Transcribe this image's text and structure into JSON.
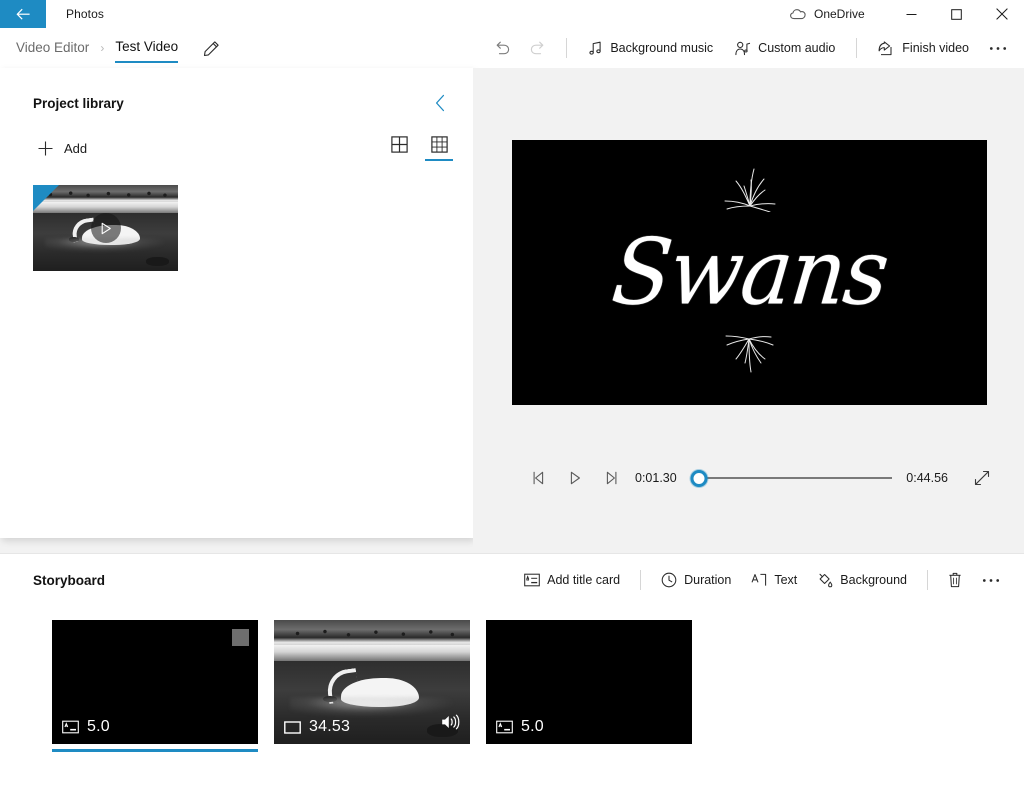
{
  "titlebar": {
    "back_icon": "back-arrow-icon",
    "app_name": "Photos",
    "onedrive_label": "OneDrive",
    "onedrive_icon": "cloud-icon",
    "minimize_icon": "minimize-icon",
    "maximize_icon": "maximize-icon",
    "close_icon": "close-icon"
  },
  "commandbar": {
    "breadcrumb": {
      "parent": "Video Editor",
      "separator": "›",
      "current": "Test Video"
    },
    "rename_icon": "pencil-icon",
    "undo_label": "Undo",
    "undo_icon": "undo-icon",
    "redo_label": "Redo",
    "redo_icon": "redo-icon",
    "background_music_label": "Background music",
    "background_music_icon": "music-note-icon",
    "custom_audio_label": "Custom audio",
    "custom_audio_icon": "person-audio-icon",
    "finish_video_label": "Finish video",
    "finish_video_icon": "share-export-icon",
    "more_label": "See more",
    "more_icon": "ellipsis-icon"
  },
  "library": {
    "title": "Project library",
    "collapse_icon": "chevron-left-icon",
    "add_label": "Add",
    "add_icon": "plus-icon",
    "view_large_icon": "grid-large-icon",
    "view_small_icon": "grid-small-icon",
    "active_view": "small",
    "items": [
      {
        "name": "swan-video-thumbnail",
        "selected": true,
        "play_icon": "play-icon"
      }
    ]
  },
  "preview": {
    "title_card_text": "Swans",
    "ornament_icon": "sparkle-icon",
    "controls": {
      "prev_frame_icon": "previous-frame-icon",
      "play_icon": "play-icon",
      "next_frame_icon": "next-frame-icon",
      "current_time": "0:01.30",
      "total_time": "0:44.56",
      "progress_percent": 4,
      "fullscreen_icon": "expand-icon"
    }
  },
  "storyboard": {
    "title": "Storyboard",
    "add_title_card_label": "Add title card",
    "add_title_card_icon": "title-card-icon",
    "duration_label": "Duration",
    "duration_icon": "clock-icon",
    "text_label": "Text",
    "text_icon": "text-icon",
    "background_label": "Background",
    "background_icon": "paint-bucket-icon",
    "delete_label": "Delete",
    "delete_icon": "trash-icon",
    "more_label": "See more",
    "more_icon": "ellipsis-icon",
    "clips": [
      {
        "kind": "title-card",
        "duration": "5.0",
        "type_icon": "title-card-icon",
        "selected": true,
        "checked": true,
        "has_audio": false
      },
      {
        "kind": "video",
        "duration": "34.53",
        "type_icon": "video-icon",
        "selected": false,
        "checked": false,
        "has_audio": true,
        "audio_icon": "speaker-icon"
      },
      {
        "kind": "title-card",
        "duration": "5.0",
        "type_icon": "title-card-icon",
        "selected": false,
        "checked": false,
        "has_audio": false
      }
    ]
  },
  "colors": {
    "accent": "#1e8bc3",
    "titlebar_bg": "#ffffff",
    "app_bg": "#f2f2f2",
    "panel_bg": "#ffffff",
    "text": "#1b1b1b",
    "muted_text": "#6b6b6b",
    "disabled_text": "#c8c8c8"
  }
}
